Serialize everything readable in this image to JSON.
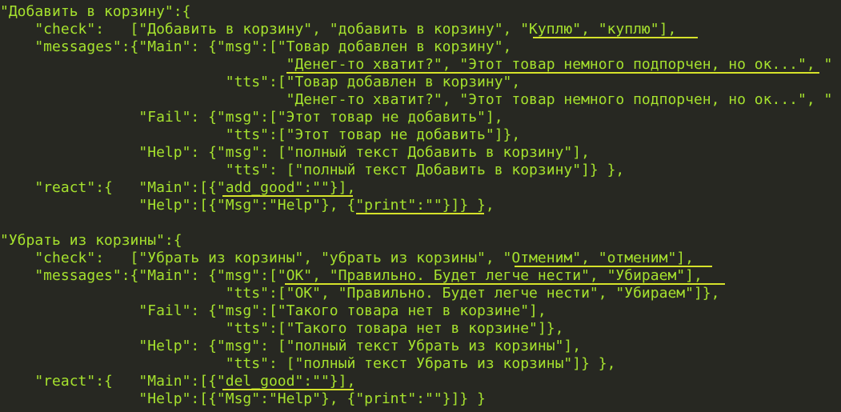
{
  "editor": {
    "lines": [
      "\"Добавить в корзину\":{",
      "    \"check\":   [\"Добавить в корзину\", \"добавить в корзину\", \"Куплю\", \"куплю\"],",
      "    \"messages\":{\"Main\": {\"msg\":[\"Товар добавлен в корзину\",",
      "                                 \"Денег-то хватит?\", \"Этот товар немного подпорчен, но ок...\", \"",
      "                          \"tts\":[\"Товар добавлен в корзину\",",
      "                                 \"Денег-то хватит?\", \"Этот товар немного подпорчен, но ок...\", \"",
      "                \"Fail\": {\"msg\":[\"Этот товар не добавить\"],",
      "                          \"tts\":[\"Этот товар не добавить\"]},",
      "                \"Help\": {\"msg\": [\"полный текст Добавить в корзину\"],",
      "                          \"tts\": [\"полный текст Добавить в корзину\"]} },",
      "    \"react\":{   \"Main\":[{\"add_good\":\"\"}],",
      "                \"Help\":[{\"Msg\":\"Help\"}, {\"print\":\"\"}]} },",
      "",
      "\"Убрать из корзины\":{",
      "    \"check\":   [\"Убрать из корзины\", \"убрать из корзины\", \"Отменим\", \"отменим\"],",
      "    \"messages\":{\"Main\": {\"msg\":[\"OK\", \"Правильно. Будет легче нести\", \"Убираем\"],",
      "                          \"tts\":[\"OK\", \"Правильно. Будет легче нести\", \"Убираем\"]},",
      "                \"Fail\": {\"msg\":[\"Такого товара нет в корзине\"],",
      "                          \"tts\":[\"Такого товара нет в корзине\"]},",
      "                \"Help\": {\"msg\": [\"полный текст Убрать из корзины\"],",
      "                          \"tts\": [\"полный текст Убрать из корзины\"]} },",
      "    \"react\":{   \"Main\":[{\"del_good\":\"\"}],",
      "                \"Help\":[{\"Msg\":\"Help\"}, {\"print\":\"\"}]} }",
      "    ,"
    ]
  },
  "colors": {
    "background": "#272822",
    "text": "#a6e22e",
    "underline": "#d6e22a"
  }
}
